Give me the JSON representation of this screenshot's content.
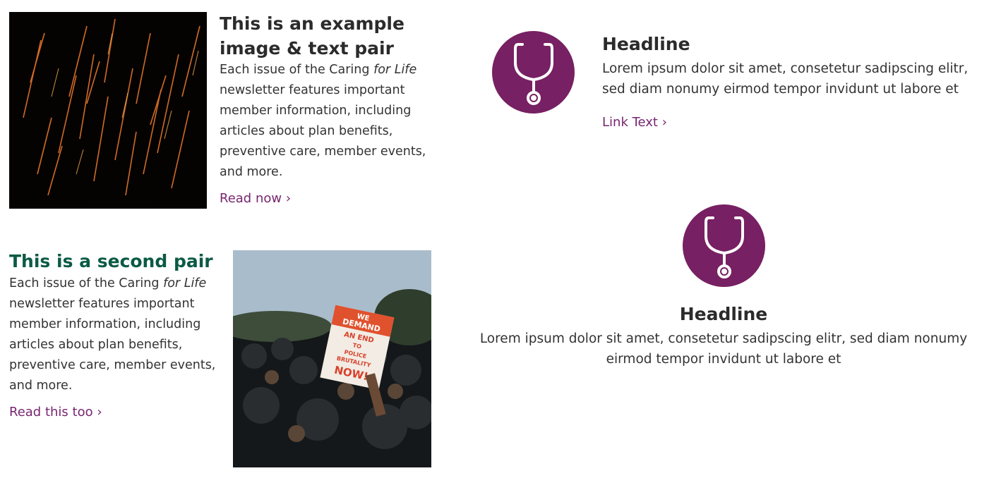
{
  "pair1": {
    "heading": "This is an example image & text pair",
    "body_pre": "Each issue of the Caring ",
    "body_em": "for Life",
    "body_post": " newsletter features important member information, including articles about plan benefits, preventive care, member events, and more.",
    "link": "Read now ›",
    "image": "sparks-photo"
  },
  "pair2": {
    "heading": "This is a second pair",
    "body_pre": "Each issue of the Caring ",
    "body_em": "for Life",
    "body_post": " newsletter features important member information, including articles about plan benefits, preventive care, member events, and more.",
    "link": "Read this too ›",
    "image": "protest-photo",
    "sign_text": [
      "WE",
      "DEMAND",
      "AN END",
      "TO",
      "POLICE",
      "BRUTALITY",
      "NOW!"
    ]
  },
  "feature1": {
    "icon": "stethoscope-icon",
    "headline": "Headline",
    "body": "Lorem ipsum dolor sit amet, consetetur sadipscing elitr, sed diam nonumy eirmod tempor invidunt ut labore et",
    "link": "Link Text ›"
  },
  "feature2": {
    "icon": "stethoscope-icon",
    "headline": "Headline",
    "body": "Lorem ipsum dolor sit amet, consetetur sadipscing elitr, sed diam nonumy eirmod tempor invidunt ut labore et"
  },
  "colors": {
    "accent_purple": "#772063",
    "link_purple": "#772670",
    "heading_green": "#0b5a45",
    "text": "#2b2b2b"
  }
}
